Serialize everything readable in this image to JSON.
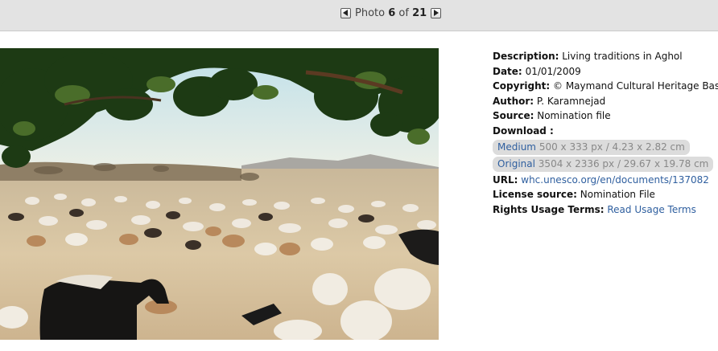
{
  "pager": {
    "prefix": "Photo",
    "current": "6",
    "of_word": "of",
    "total": "21",
    "prev_icon": "triangle-left-icon",
    "next_icon": "triangle-right-icon"
  },
  "photo": {
    "subject": "goats-and-sheep-herd-photo"
  },
  "meta": {
    "description_label": "Description:",
    "description": "Living traditions in Aghol",
    "date_label": "Date:",
    "date": "01/01/2009",
    "copyright_label": "Copyright:",
    "copyright": "© Maymand Cultural Heritage Base",
    "author_label": "Author:",
    "author": "P. Karamnejad",
    "source_label": "Source:",
    "source": "Nomination file",
    "download_label": "Download :",
    "downloads": [
      {
        "name": "Medium",
        "info": "500 x 333 px / 4.23 x 2.82 cm"
      },
      {
        "name": "Original",
        "info": "3504 x 2336 px / 29.67 x 19.78 cm"
      }
    ],
    "url_label": "URL:",
    "url": "whc.unesco.org/en/documents/137082",
    "license_label": "License source:",
    "license": "Nomination File",
    "rights_label": "Rights Usage Terms:",
    "rights_link": "Read Usage Terms"
  },
  "colors": {
    "link": "#2f5f9f",
    "topbar": "#e3e3e3",
    "pill": "#dcdcdc"
  }
}
